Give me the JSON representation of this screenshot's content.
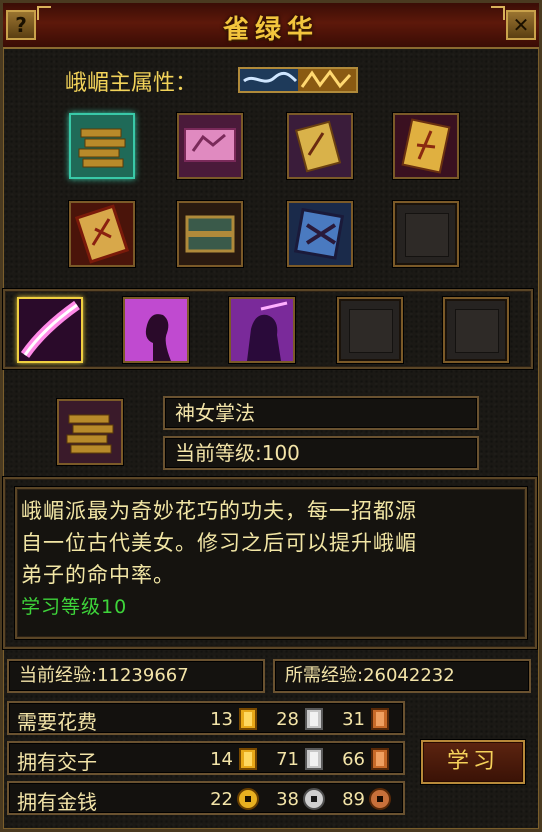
{
  "window": {
    "title": "雀绿华",
    "help_label": "?",
    "close_label": "✕"
  },
  "attribute": {
    "label": "峨嵋主属性："
  },
  "skill": {
    "name": "神女掌法",
    "level_text": "当前等级:100",
    "description_lines": [
      "峨嵋派最为奇妙花巧的功夫，每一招都源",
      "自一位古代美女。修习之后可以提升峨嵋",
      "弟子的命中率。"
    ],
    "learn_level": "学习等级10"
  },
  "exp": {
    "current": "当前经验:11239667",
    "required": "所需经验:26042232"
  },
  "costs": {
    "need": {
      "label": "需要花费",
      "gold": "13",
      "silver": "28",
      "copper": "31"
    },
    "jiaozi": {
      "label": "拥有交子",
      "gold": "14",
      "silver": "71",
      "copper": "66"
    },
    "money": {
      "label": "拥有金钱",
      "gold": "22",
      "silver": "38",
      "copper": "89"
    }
  },
  "buttons": {
    "learn": "学习"
  },
  "colors": {
    "title": "#f2c53d",
    "text": "#f3e4a8",
    "learn_level": "#3ed43a",
    "frame": "#7b5a28"
  }
}
